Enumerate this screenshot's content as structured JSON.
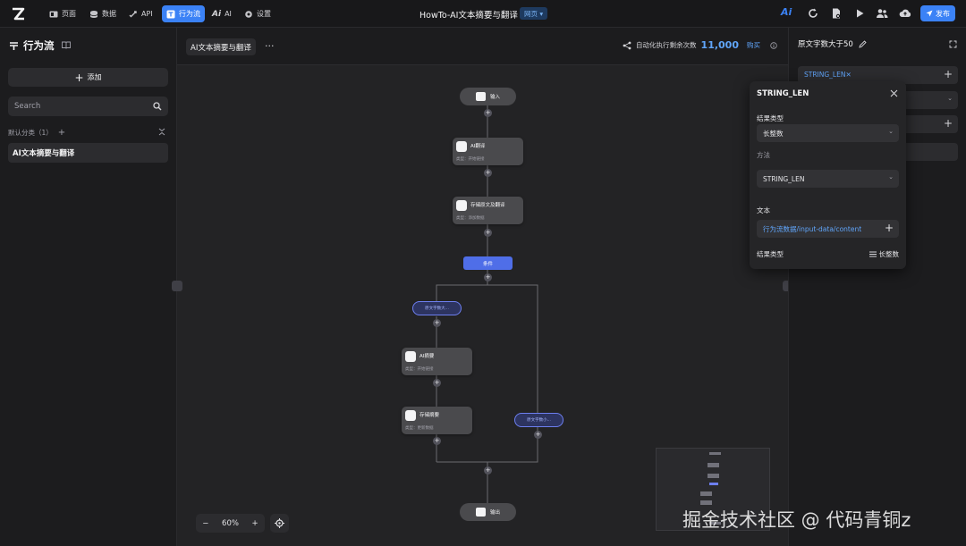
{
  "topbar": {
    "nav": [
      {
        "label": "页面",
        "icon": "page-icon"
      },
      {
        "label": "数据",
        "icon": "database-icon"
      },
      {
        "label": "API",
        "icon": "api-icon"
      },
      {
        "label": "行为流",
        "icon": "flow-icon",
        "active": true
      },
      {
        "label": "AI",
        "icon": "ai-icon"
      },
      {
        "label": "设置",
        "icon": "gear-icon"
      }
    ],
    "app_title": "HowTo-AI文本摘要与翻译",
    "page_badge": "网页 ▾",
    "publish_label": "发布",
    "ai_label": "Ai",
    "accent": "#3b82f6"
  },
  "sidebar": {
    "title": "行为流",
    "add_label": "添加",
    "search_placeholder": "Search",
    "category_label": "默认分类（1）",
    "flows": [
      "AI文本摘要与翻译"
    ]
  },
  "canvas": {
    "flow_tab": "AI文本摘要与翻译",
    "quota_label": "自动化执行剩余次数",
    "quota_value": "11,000",
    "buy_label": "购买",
    "zoom": "60%",
    "nodes": {
      "input": "输入",
      "translate": {
        "title": "AI翻译",
        "sub": "类型：开始链接"
      },
      "save_orig": {
        "title": "存储原文及翻译",
        "sub": "类型：添加数据"
      },
      "condition": "条件",
      "branch_true": "原文字数大...",
      "summary": {
        "title": "AI摘要",
        "sub": "类型：开始链接"
      },
      "save_summary": {
        "title": "存储摘要",
        "sub": "类型：更新数据"
      },
      "branch_else": "原文字数小...",
      "output": "输出"
    }
  },
  "right_panel": {
    "title": "原文字数大于50",
    "chip": "STRING_LEN✕"
  },
  "popover": {
    "title": "STRING_LEN",
    "result_type_label": "结果类型",
    "result_type_value": "长整数",
    "method_label": "方法",
    "method_value": "STRING_LEN",
    "text_label": "文本",
    "text_value": "行为流数据/input-data/content",
    "result_type_label2": "结果类型",
    "result_type_value2": "长整数"
  },
  "watermark": "掘金技术社区 @ 代码青铜z"
}
